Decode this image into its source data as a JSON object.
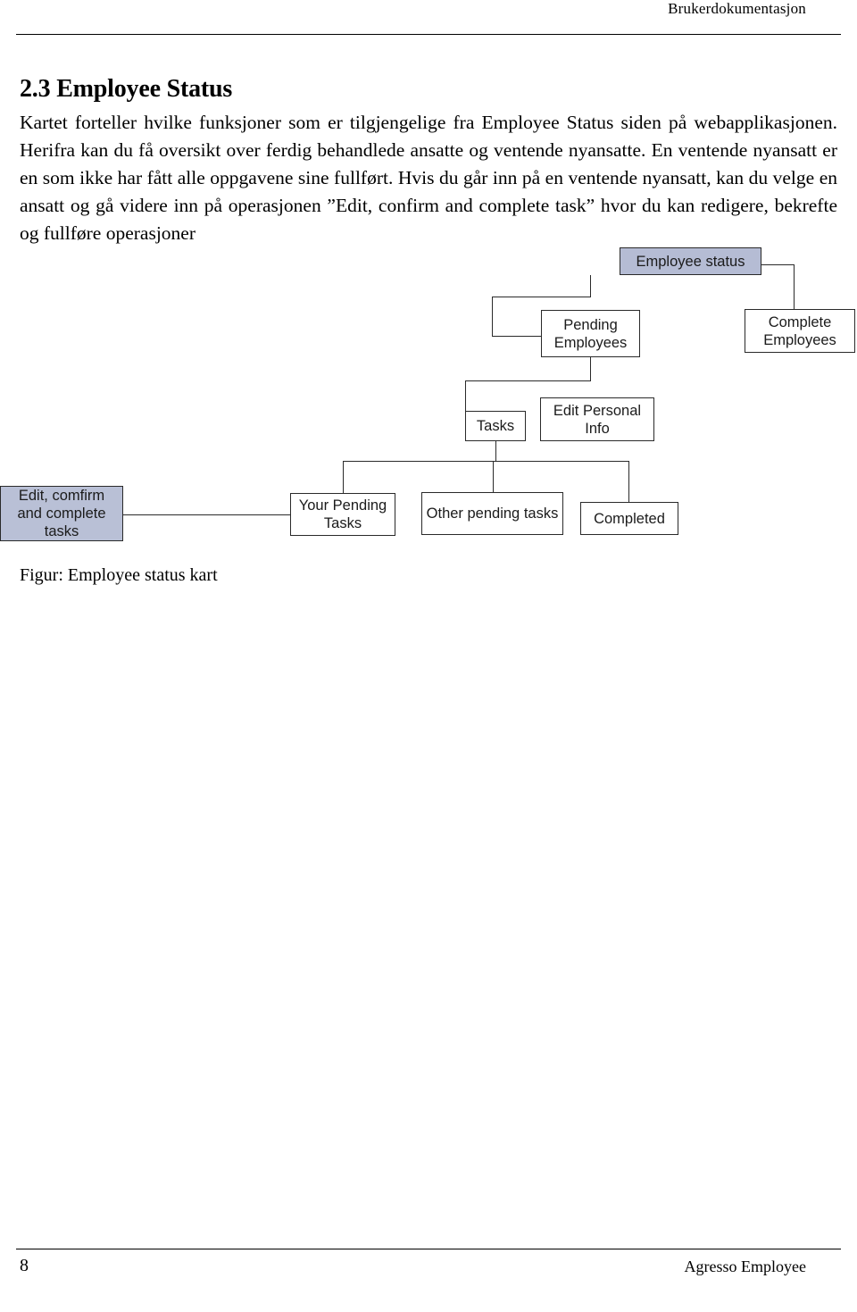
{
  "header": {
    "title": "Brukerdokumentasjon"
  },
  "section": {
    "heading": "2.3 Employee Status",
    "paragraph": "Kartet forteller hvilke funksjoner som er tilgjengelige fra Employee Status siden på webapplikasjonen.  Herifra kan du få oversikt over ferdig behandlede ansatte og ventende nyansatte. En ventende nyansatt er en som ikke har fått alle oppgavene sine fullført. Hvis du går inn på en ventende nyansatt, kan du velge en ansatt og gå videre inn på operasjonen ”Edit, confirm and complete task” hvor du kan redigere, bekrefte og fullføre operasjoner"
  },
  "diagram": {
    "nodes": [
      {
        "id": "employee-status",
        "label": "Employee status"
      },
      {
        "id": "pending-employees",
        "label": "Pending Employees"
      },
      {
        "id": "complete-employees",
        "label": "Complete Employees"
      },
      {
        "id": "tasks",
        "label": "Tasks"
      },
      {
        "id": "edit-personal-info",
        "label": "Edit Personal Info"
      },
      {
        "id": "edit-confirm-complete-tasks",
        "label": "Edit, comfirm and complete tasks"
      },
      {
        "id": "your-pending-tasks",
        "label": "Your Pending Tasks"
      },
      {
        "id": "other-pending-tasks",
        "label": "Other pending tasks"
      },
      {
        "id": "completed",
        "label": "Completed"
      }
    ],
    "shaded_color": "#b5bcd4",
    "line_color": "#2a2a2a"
  },
  "caption": "Figur: Employee status kart",
  "footer": {
    "page_number": "8",
    "product": "Agresso Employee"
  }
}
